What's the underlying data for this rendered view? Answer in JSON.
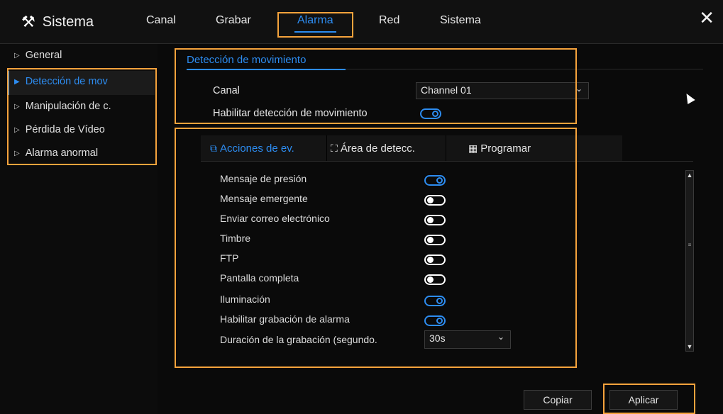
{
  "app": {
    "title": "Sistema",
    "brand_icon": "tools-icon"
  },
  "nav": {
    "tabs": [
      "Canal",
      "Grabar",
      "Alarma",
      "Red",
      "Sistema"
    ],
    "active": "Alarma"
  },
  "sidebar": {
    "items": [
      {
        "label": "General"
      },
      {
        "label": "Detección de mov"
      },
      {
        "label": "Manipulación de c."
      },
      {
        "label": "Pérdida de Vídeo"
      },
      {
        "label": "Alarma anormal"
      }
    ],
    "active_index": 1
  },
  "section": {
    "title": "Detección de movimiento",
    "channel_label": "Canal",
    "channel_value": "Channel 01",
    "enable_label": "Habilitar detección de movimiento",
    "enable_on": true
  },
  "subtabs": [
    {
      "label": "Acciones de ev.",
      "icon": "event-actions-icon"
    },
    {
      "label": "Área de detecc.",
      "icon": "detection-area-icon"
    },
    {
      "label": "Programar",
      "icon": "calendar-icon"
    }
  ],
  "events": [
    {
      "label": "Mensaje de presión",
      "on": true
    },
    {
      "label": "Mensaje emergente",
      "on": false
    },
    {
      "label": "Enviar correo electrónico",
      "on": false
    },
    {
      "label": "Timbre",
      "on": false
    },
    {
      "label": "FTP",
      "on": false
    },
    {
      "label": "Pantalla completa",
      "on": false
    },
    {
      "label": "Iluminación",
      "on": true
    },
    {
      "label": "Habilitar grabación de alarma",
      "on": true
    }
  ],
  "duration": {
    "label": "Duración de la grabación (segundo.",
    "value": "30s"
  },
  "buttons": {
    "copy": "Copiar",
    "apply": "Aplicar"
  },
  "colors": {
    "accent": "#2d8cf0",
    "highlight": "#f5a33c"
  }
}
